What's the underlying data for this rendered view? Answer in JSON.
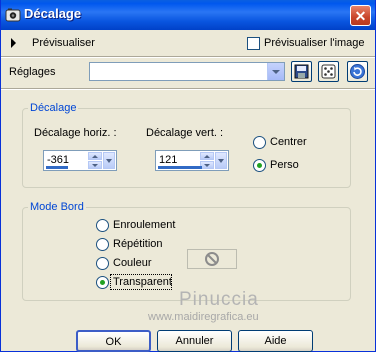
{
  "window": {
    "title": "Décalage"
  },
  "preview": {
    "toggle_label": "Prévisualiser",
    "checkbox_label": "Prévisualiser l'image",
    "checked": false
  },
  "presets": {
    "label": "Réglages",
    "value": ""
  },
  "offset_group": {
    "title": "Décalage",
    "horiz_label": "Décalage horiz. :",
    "horiz_value": "-361",
    "vert_label": "Décalage vert. :",
    "vert_value": "121",
    "options": [
      {
        "label": "Centrer",
        "selected": false
      },
      {
        "label": "Perso",
        "selected": true
      }
    ]
  },
  "edge_group": {
    "title": "Mode Bord",
    "options": [
      {
        "label": "Enroulement",
        "selected": false
      },
      {
        "label": "Répétition",
        "selected": false
      },
      {
        "label": "Couleur",
        "selected": false
      },
      {
        "label": "Transparent",
        "selected": true
      }
    ]
  },
  "watermark": {
    "name": "Pinuccia",
    "url": "www.maidiregrafica.eu"
  },
  "buttons": {
    "ok": "OK",
    "cancel": "Annuler",
    "help": "Aide"
  },
  "icons": {
    "app": "app-icon",
    "close": "close-icon",
    "save": "save-preset-icon",
    "random": "random-dice-icon",
    "reset": "reset-icon",
    "no_color": "no-color-icon"
  },
  "colors": {
    "title_bar": "#0058ee",
    "group_title": "#0046d5",
    "radio_dot": "#21a121",
    "spin_bar": "#316ac5"
  }
}
